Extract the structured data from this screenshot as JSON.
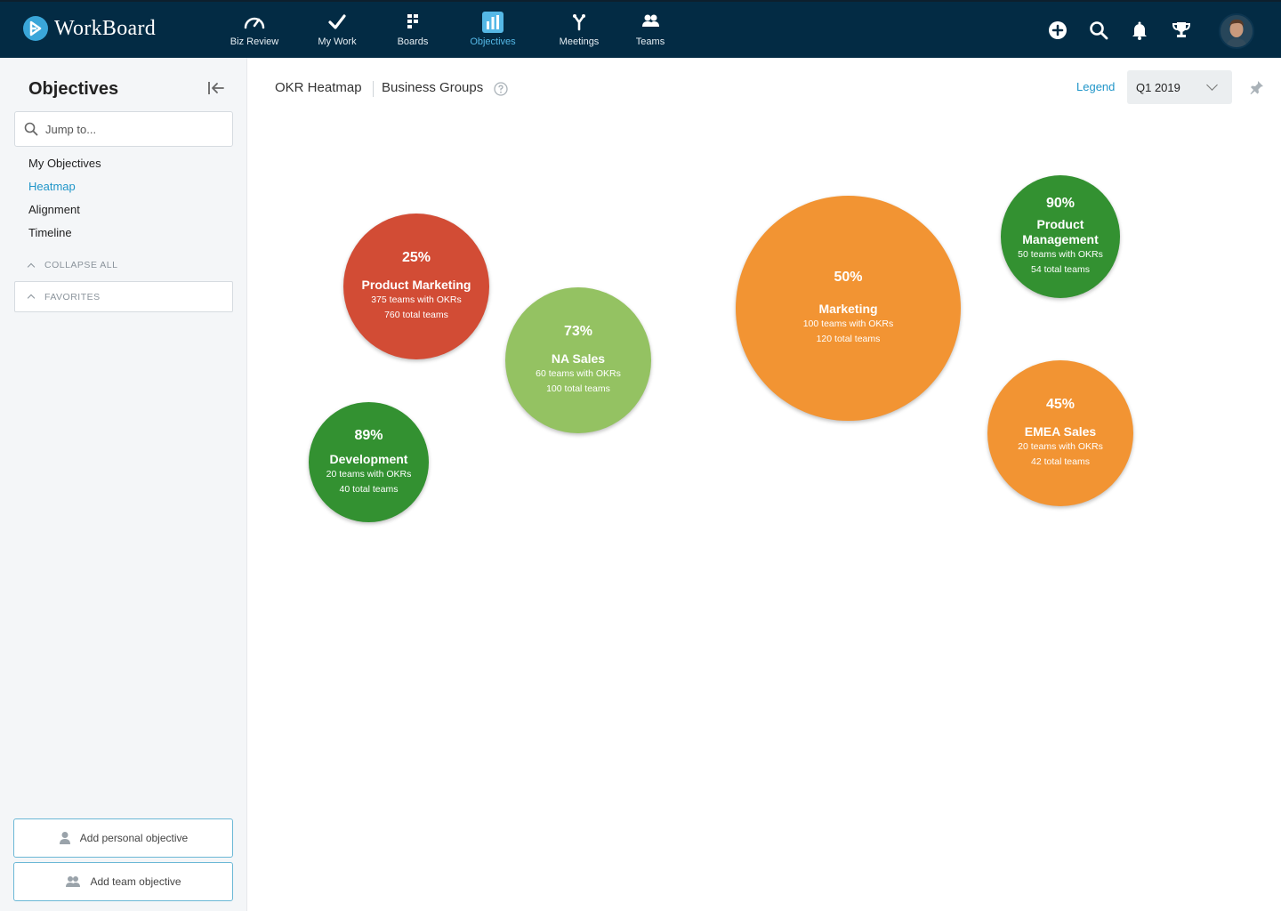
{
  "brand": {
    "name": "WorkBoard"
  },
  "nav": {
    "items": [
      {
        "label": "Biz Review",
        "icon": "gauge-icon"
      },
      {
        "label": "My Work",
        "icon": "check-icon"
      },
      {
        "label": "Boards",
        "icon": "boards-icon"
      },
      {
        "label": "Objectives",
        "icon": "bar-chart-icon",
        "active": true
      },
      {
        "label": "Meetings",
        "icon": "meetings-icon"
      },
      {
        "label": "Teams",
        "icon": "teams-icon"
      }
    ],
    "actions": [
      "add-icon",
      "search-icon",
      "bell-icon",
      "trophy-icon"
    ]
  },
  "sidebar": {
    "title": "Objectives",
    "search_placeholder": "Jump to...",
    "links": [
      {
        "label": "My Objectives",
        "active": false
      },
      {
        "label": "Heatmap",
        "active": true
      },
      {
        "label": "Alignment",
        "active": false
      },
      {
        "label": "Timeline",
        "active": false
      }
    ],
    "collapse_all": "COLLAPSE ALL",
    "favorites": "FAVORITES",
    "add_personal": "Add personal objective",
    "add_team": "Add team objective"
  },
  "header": {
    "breadcrumb_1": "OKR Heatmap",
    "breadcrumb_2": "Business Groups",
    "legend": "Legend",
    "quarter": "Q1 2019"
  },
  "colors": {
    "red": "#d24c35",
    "light_green": "#94c262",
    "green": "#339131",
    "orange": "#f29433",
    "accent": "#2196c9",
    "nav_bg": "#032b44"
  },
  "heatmap": {
    "groups": [
      {
        "name": "Product Marketing",
        "percent": "25%",
        "with_okrs": "375 teams with OKRs",
        "total": "760 total teams",
        "color": "#d24c35"
      },
      {
        "name": "NA Sales",
        "percent": "73%",
        "with_okrs": "60 teams with OKRs",
        "total": "100 total teams",
        "color": "#94c262"
      },
      {
        "name": "Development",
        "percent": "89%",
        "with_okrs": "20 teams with OKRs",
        "total": "40 total teams",
        "color": "#339131"
      },
      {
        "name": "Marketing",
        "percent": "50%",
        "with_okrs": "100 teams with OKRs",
        "total": "120 total teams",
        "color": "#f29433"
      },
      {
        "name": "Product Management",
        "percent": "90%",
        "with_okrs": "50 teams with OKRs",
        "total": "54 total teams",
        "color": "#339131"
      },
      {
        "name": "EMEA Sales",
        "percent": "45%",
        "with_okrs": "20 teams with OKRs",
        "total": "42 total teams",
        "color": "#f29433"
      }
    ]
  }
}
